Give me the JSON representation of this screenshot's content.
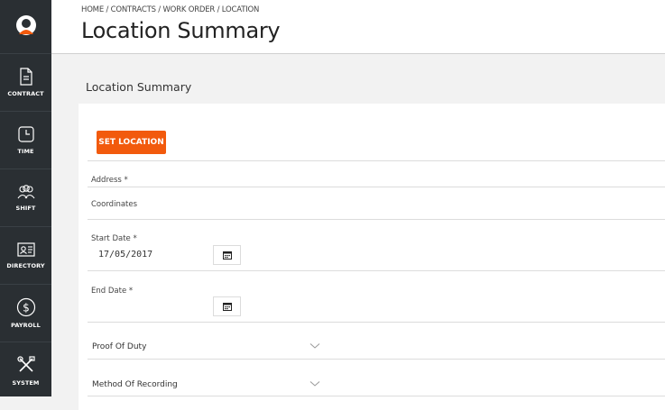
{
  "sidebar": {
    "items": [
      {
        "label": "CONTRACT",
        "icon": "document-icon"
      },
      {
        "label": "TIME",
        "icon": "clock-icon"
      },
      {
        "label": "SHIFT",
        "icon": "people-icon"
      },
      {
        "label": "DIRECTORY",
        "icon": "contact-card-icon"
      },
      {
        "label": "PAYROLL",
        "icon": "dollar-icon"
      },
      {
        "label": "SYSTEM",
        "icon": "tools-icon"
      }
    ]
  },
  "header": {
    "breadcrumb": "HOME / CONTRACTS / WORK ORDER / LOCATION",
    "title": "Location Summary"
  },
  "main": {
    "section_title": "Location Summary",
    "set_location_label": "SET LOCATION",
    "address_label": "Address *",
    "coordinates_label": "Coordinates",
    "start_date_label": "Start Date *",
    "start_date_value": "17/05/2017",
    "end_date_label": "End Date *",
    "end_date_value": "",
    "proof_of_duty_label": "Proof Of Duty",
    "method_of_recording_label": "Method Of Recording"
  },
  "colors": {
    "sidebar_bg": "#2a2f33",
    "accent": "#f25a0d"
  }
}
